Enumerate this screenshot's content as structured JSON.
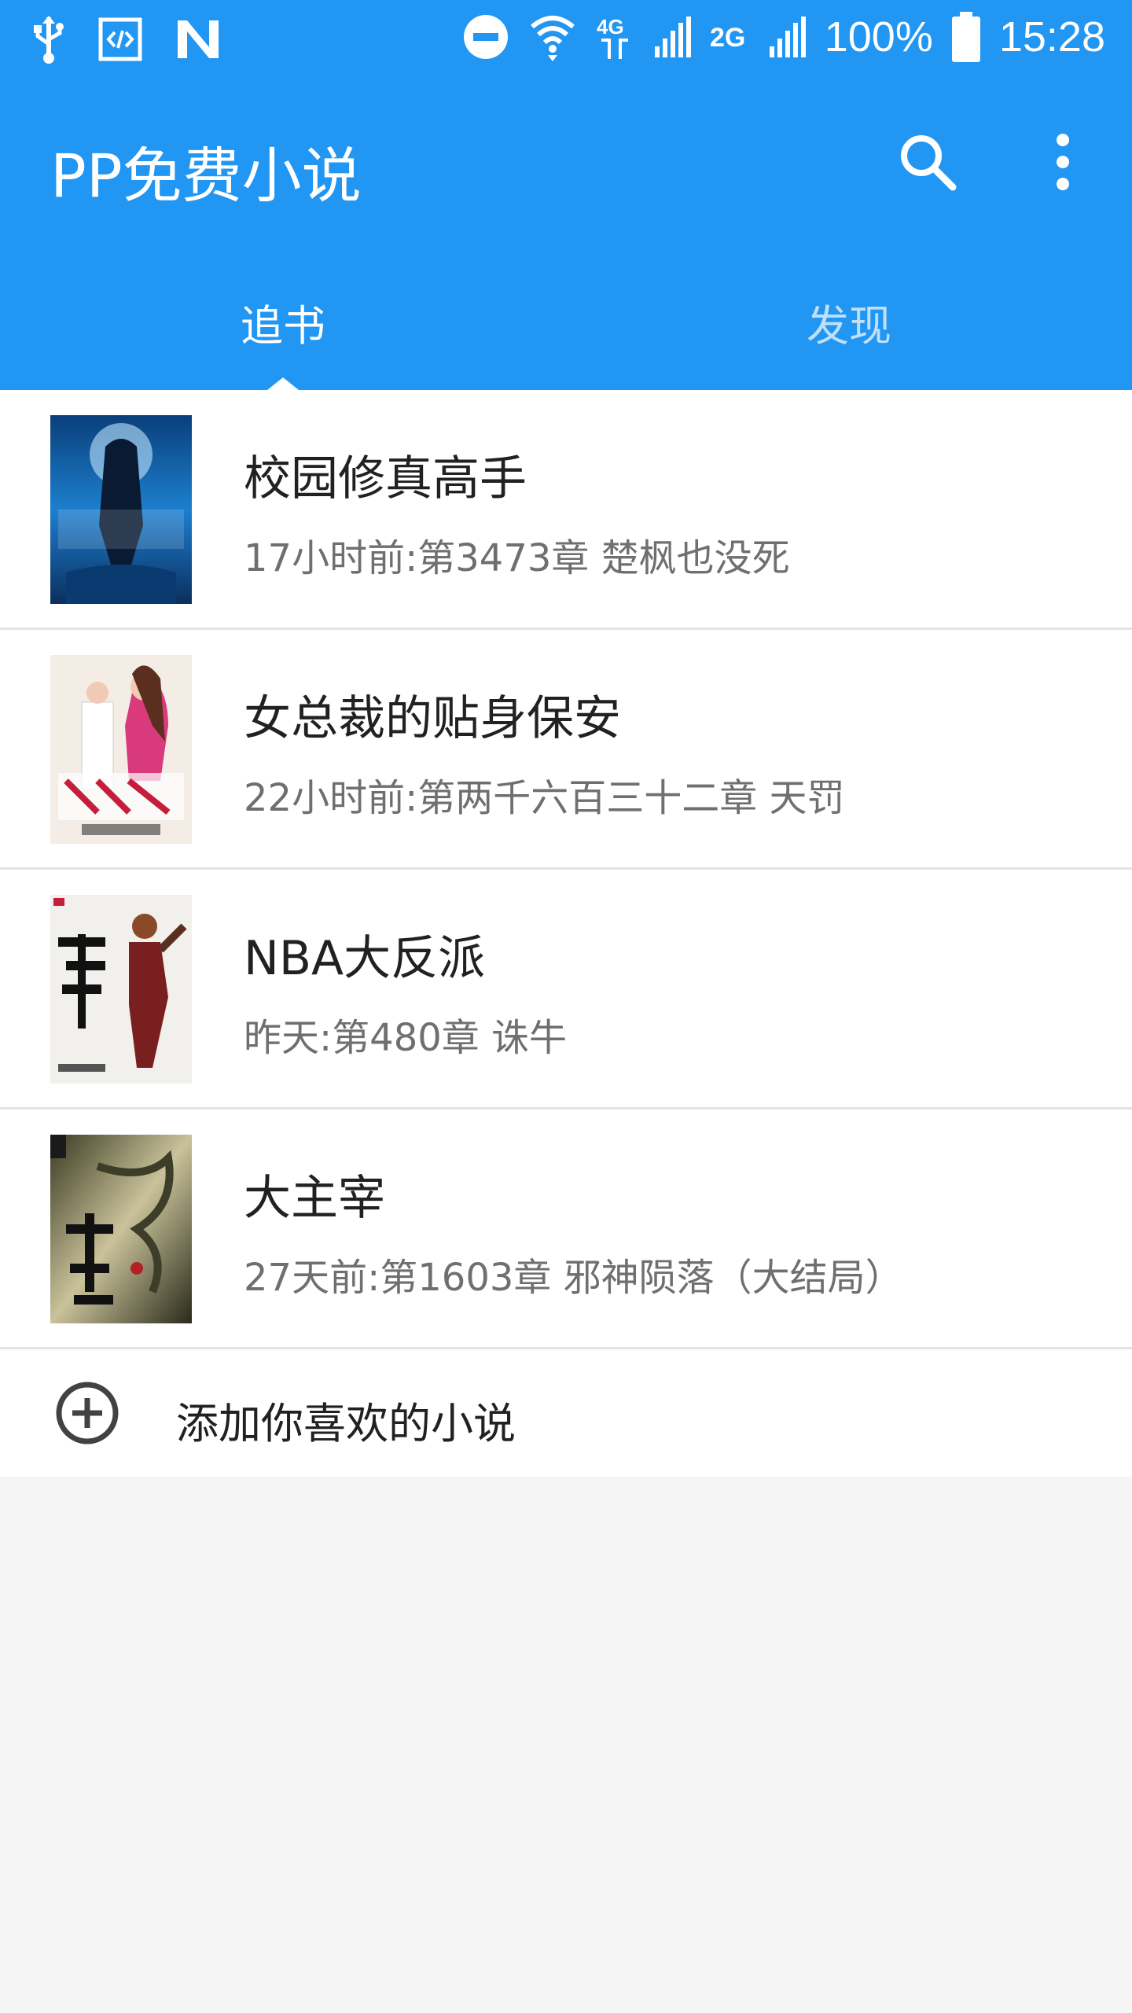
{
  "status_bar": {
    "icons": [
      "usb-icon",
      "code-icon",
      "n-notification-icon",
      "dnd-icon",
      "wifi-icon",
      "4g-icon",
      "signal-icon",
      "2g-icon",
      "signal-icon",
      "battery-icon"
    ],
    "battery": "100%",
    "time": "15:28"
  },
  "app_bar": {
    "title": "PP免费小说",
    "search_icon": "search-icon",
    "menu_icon": "more-vert-icon"
  },
  "tabs": [
    {
      "label": "追书",
      "active": true
    },
    {
      "label": "发现",
      "active": false
    }
  ],
  "books": [
    {
      "title": "校园修真高手",
      "update": "17小时前:第3473章 楚枫也没死"
    },
    {
      "title": "女总裁的贴身保安",
      "update": "22小时前:第两千六百三十二章 天罚"
    },
    {
      "title": "NBA大反派",
      "update": "昨天:第480章 诛牛"
    },
    {
      "title": "大主宰",
      "update": "27天前:第1603章 邪神陨落（大结局）"
    }
  ],
  "add_row": {
    "label": "添加你喜欢的小说"
  },
  "colors": {
    "primary": "#2196F3",
    "background": "#f5f5f5"
  }
}
